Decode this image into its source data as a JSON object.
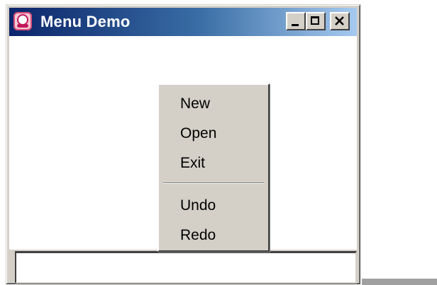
{
  "window": {
    "title": "Menu Demo",
    "app_icon": "java-app-icon",
    "caption_buttons": {
      "minimize": "minimize-icon",
      "maximize": "maximize-icon",
      "close": "close-icon"
    }
  },
  "popup_menu": {
    "items": [
      {
        "label": "New"
      },
      {
        "label": "Open"
      },
      {
        "label": "Exit"
      }
    ],
    "items_after_separator": [
      {
        "label": "Undo"
      },
      {
        "label": "Redo"
      }
    ]
  },
  "text_field": {
    "value": ""
  },
  "colors": {
    "titlebar_start": "#0a246a",
    "titlebar_end": "#a6caf0",
    "menu_background": "#d4d0c8",
    "content_background": "#ffffff"
  }
}
